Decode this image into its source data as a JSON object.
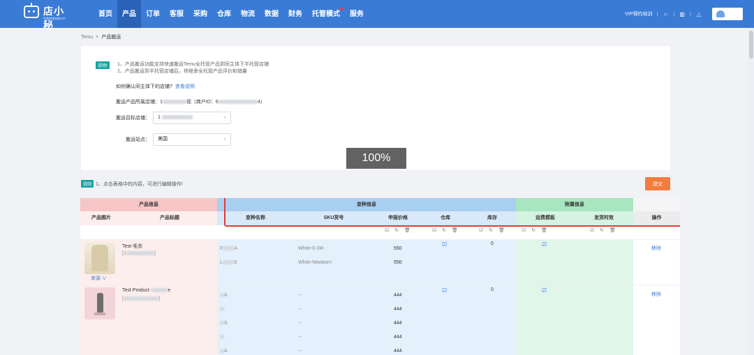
{
  "app": {
    "logo_text": "店小秘",
    "logo_sub": "免费跨境电商ERP"
  },
  "nav": [
    {
      "label": "首页",
      "active": false
    },
    {
      "label": "产品",
      "active": true
    },
    {
      "label": "订单",
      "active": false
    },
    {
      "label": "客服",
      "active": false
    },
    {
      "label": "采购",
      "active": false
    },
    {
      "label": "仓库",
      "active": false
    },
    {
      "label": "物流",
      "active": false
    },
    {
      "label": "数据",
      "active": false
    },
    {
      "label": "财务",
      "active": false
    },
    {
      "label": "托管模式",
      "active": false,
      "dot": true
    },
    {
      "label": "服务",
      "active": false
    }
  ],
  "topright": {
    "vip": "VIP预约培训",
    "headset_icon": "headset-icon",
    "book_icon": "book-icon",
    "bell_icon": "bell-icon"
  },
  "breadcrumb": {
    "root": "Temu",
    "sep": ">",
    "current": "产品搬运"
  },
  "card": {
    "badge": "说明!",
    "note1": "1、产品搬运功能支持快速搬运Temu全托管产品到同主体下半托管店铺",
    "note2": "2、产品搬运到半托管店铺后，将继承全托管产品评价和销量",
    "confirm_text": "如何确认同主体下的店铺?",
    "confirm_link": "查看说明",
    "source_label": "搬运产品所属店铺：",
    "source_prefix": "1",
    "source_suffix": "视（商户ID：6",
    "source_end": "4）",
    "target_label": "搬运目标店铺：",
    "target_value": "1",
    "site_label": "搬运站点：",
    "site_value": "美国",
    "caret": "∨",
    "zoom": "100%"
  },
  "tip": {
    "badge": "说明",
    "text": "1、点击表格中的内容，可进行编辑操作!"
  },
  "submit_label": "提交",
  "table": {
    "groups": {
      "product": "产品信息",
      "variant": "变种信息",
      "attached": "附属信息"
    },
    "headers": {
      "image": "产品图片",
      "title": "产品标题",
      "variant_name": "变种名称",
      "sku": "SKU货号",
      "price": "申报价格",
      "warehouse": "仓库",
      "stock": "库存",
      "shipping_template": "运费模板",
      "delivery_time": "发货时效",
      "action": "操作"
    },
    "tools": "☑ ↻ 🗑",
    "products": [
      {
        "title": "Test-毛衣",
        "title_sub": "[1",
        "title_sub_end": "]",
        "source": "来源 ∨",
        "stock": "0",
        "action": "移除",
        "variants": [
          {
            "name_a": "F",
            "name_b": "A",
            "sku": "White-0-3M",
            "price": "550"
          },
          {
            "name_a": "L",
            "name_b": "S",
            "sku": "White-Newborn",
            "price": "550"
          }
        ]
      },
      {
        "title": "Test Product -",
        "title_end": "e",
        "title_sub": "[",
        "title_sub_end": "]",
        "stock": "0",
        "action": "移除",
        "variants": [
          {
            "name_a": "A",
            "sku": "--",
            "price": "444"
          },
          {
            "name_a": "",
            "sku": "--",
            "price": "444"
          },
          {
            "name_a": "S",
            "sku": "--",
            "price": "444"
          },
          {
            "name_a": "",
            "sku": "--",
            "price": "444"
          },
          {
            "name_a": "A",
            "sku": "--",
            "price": "444"
          }
        ]
      }
    ]
  },
  "colors": {
    "nav_bg": "#3a7bd5",
    "product_group": "#f6c6c6",
    "variant_group": "#a9cff1",
    "attached_group": "#a8e6c1",
    "submit": "#f47c3c",
    "highlight_box": "#e53935"
  }
}
